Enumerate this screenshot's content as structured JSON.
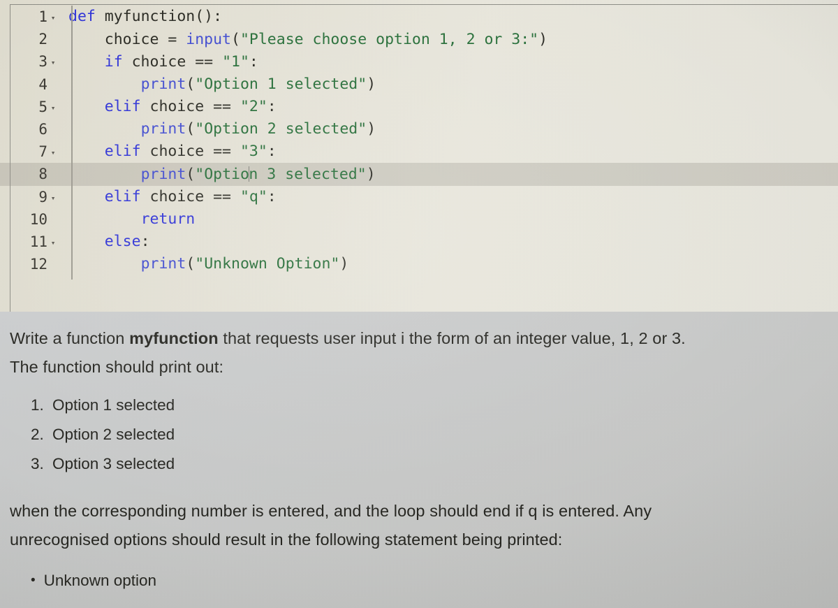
{
  "editor": {
    "language": "python",
    "active_line": 8,
    "colors": {
      "background": "#e6e4d9",
      "keyword": "#2b2fd6",
      "function": "#3d48cf",
      "string": "#226b34",
      "plain": "#26261f",
      "gutter_text": "#35332c",
      "active_line_highlight": "#8e8c80"
    },
    "fold_marker": "▾",
    "lines": [
      {
        "number": "1",
        "fold": true,
        "active": false,
        "tokens": [
          {
            "t": "kw",
            "v": "def"
          },
          {
            "t": "pl",
            "v": " myfunction():"
          }
        ]
      },
      {
        "number": "2",
        "fold": false,
        "active": false,
        "tokens": [
          {
            "t": "pl",
            "v": "    choice = "
          },
          {
            "t": "fn",
            "v": "input"
          },
          {
            "t": "pl",
            "v": "("
          },
          {
            "t": "str",
            "v": "\"Please choose option 1, 2 or 3:\""
          },
          {
            "t": "pl",
            "v": ")"
          }
        ]
      },
      {
        "number": "3",
        "fold": true,
        "active": false,
        "tokens": [
          {
            "t": "pl",
            "v": "    "
          },
          {
            "t": "kw",
            "v": "if"
          },
          {
            "t": "pl",
            "v": " choice == "
          },
          {
            "t": "str",
            "v": "\"1\""
          },
          {
            "t": "pl",
            "v": ":"
          }
        ]
      },
      {
        "number": "4",
        "fold": false,
        "active": false,
        "tokens": [
          {
            "t": "pl",
            "v": "        "
          },
          {
            "t": "fn",
            "v": "print"
          },
          {
            "t": "pl",
            "v": "("
          },
          {
            "t": "str",
            "v": "\"Option 1 selected\""
          },
          {
            "t": "pl",
            "v": ")"
          }
        ]
      },
      {
        "number": "5",
        "fold": true,
        "active": false,
        "tokens": [
          {
            "t": "pl",
            "v": "    "
          },
          {
            "t": "kw",
            "v": "elif"
          },
          {
            "t": "pl",
            "v": " choice == "
          },
          {
            "t": "str",
            "v": "\"2\""
          },
          {
            "t": "pl",
            "v": ":"
          }
        ]
      },
      {
        "number": "6",
        "fold": false,
        "active": false,
        "tokens": [
          {
            "t": "pl",
            "v": "        "
          },
          {
            "t": "fn",
            "v": "print"
          },
          {
            "t": "pl",
            "v": "("
          },
          {
            "t": "str",
            "v": "\"Option 2 selected\""
          },
          {
            "t": "pl",
            "v": ")"
          }
        ]
      },
      {
        "number": "7",
        "fold": true,
        "active": false,
        "tokens": [
          {
            "t": "pl",
            "v": "    "
          },
          {
            "t": "kw",
            "v": "elif"
          },
          {
            "t": "pl",
            "v": " choice == "
          },
          {
            "t": "str",
            "v": "\"3\""
          },
          {
            "t": "pl",
            "v": ":"
          }
        ]
      },
      {
        "number": "8",
        "fold": false,
        "active": true,
        "caret_after": "        print(\"Optio",
        "tokens": [
          {
            "t": "pl",
            "v": "        "
          },
          {
            "t": "fn",
            "v": "print"
          },
          {
            "t": "pl",
            "v": "("
          },
          {
            "t": "str",
            "v": "\"Optio"
          },
          {
            "t": "caret",
            "v": ""
          },
          {
            "t": "str",
            "v": "n 3 selected\""
          },
          {
            "t": "pl",
            "v": ")"
          }
        ]
      },
      {
        "number": "9",
        "fold": true,
        "active": false,
        "tokens": [
          {
            "t": "pl",
            "v": "    "
          },
          {
            "t": "kw",
            "v": "elif"
          },
          {
            "t": "pl",
            "v": " choice == "
          },
          {
            "t": "str",
            "v": "\"q\""
          },
          {
            "t": "pl",
            "v": ":"
          }
        ]
      },
      {
        "number": "10",
        "fold": false,
        "active": false,
        "tokens": [
          {
            "t": "pl",
            "v": "        "
          },
          {
            "t": "kw",
            "v": "return"
          }
        ]
      },
      {
        "number": "11",
        "fold": true,
        "active": false,
        "tokens": [
          {
            "t": "pl",
            "v": "    "
          },
          {
            "t": "kw",
            "v": "else"
          },
          {
            "t": "pl",
            "v": ":"
          }
        ]
      },
      {
        "number": "12",
        "fold": false,
        "active": false,
        "tokens": [
          {
            "t": "pl",
            "v": "        "
          },
          {
            "t": "fn",
            "v": "print"
          },
          {
            "t": "pl",
            "v": "("
          },
          {
            "t": "str",
            "v": "\"Unknown Option\""
          },
          {
            "t": "pl",
            "v": ")"
          }
        ]
      }
    ]
  },
  "prose": {
    "intro": {
      "before_bold": "Write a function ",
      "bold_term": "myfunction",
      "after_bold": " that requests user input i the form of an integer value, 1, 2 or 3.",
      "line2": "The function should print out:"
    },
    "numbered_list": [
      {
        "marker": "1.",
        "text": "Option 1 selected"
      },
      {
        "marker": "2.",
        "text": "Option 2 selected"
      },
      {
        "marker": "3.",
        "text": "Option 3 selected"
      }
    ],
    "closing": {
      "line1": "when the corresponding number is entered, and the loop should end if q is entered.  Any",
      "line2": "unrecognised options should result in the following statement being printed:"
    },
    "bullet_list": [
      {
        "bullet": "•",
        "text": "Unknown option"
      }
    ]
  }
}
